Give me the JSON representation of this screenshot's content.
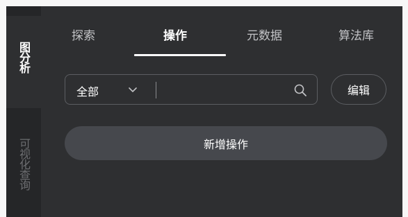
{
  "sidebar": {
    "items": [
      {
        "label": "图分析",
        "active": true
      },
      {
        "label": "可视化查询",
        "active": false
      }
    ]
  },
  "tabs": [
    {
      "label": "探索",
      "active": false
    },
    {
      "label": "操作",
      "active": true
    },
    {
      "label": "元数据",
      "active": false
    },
    {
      "label": "算法库",
      "active": false
    }
  ],
  "search": {
    "filter_value": "全部",
    "value": "",
    "placeholder": "",
    "icon": "search-icon"
  },
  "edit_button": {
    "label": "编辑"
  },
  "add_button": {
    "label": "新增操作"
  },
  "colors": {
    "panel_bg": "#2e2f31",
    "rail_bg": "#252628",
    "button_bg": "#46484d",
    "border": "#5c5e62",
    "text_active": "#ffffff",
    "text_inactive": "#c2c3c6"
  }
}
